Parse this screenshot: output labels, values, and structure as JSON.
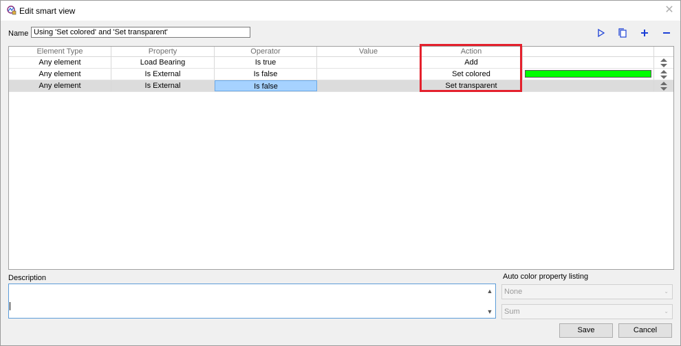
{
  "window": {
    "title": "Edit smart view",
    "close_glyph": "✕"
  },
  "name_field": {
    "label": "Name",
    "value": "Using 'Set colored' and 'Set transparent'"
  },
  "toolbar": {
    "icons": [
      "run-icon",
      "copy-icon",
      "add-icon",
      "remove-icon"
    ]
  },
  "grid": {
    "columns": [
      "Element Type",
      "Property",
      "Operator",
      "Value",
      "Action",
      "",
      ""
    ],
    "rows": [
      {
        "element_type": "Any element",
        "property": "Load Bearing",
        "operator": "Is true",
        "value": "",
        "action": "Add",
        "color": ""
      },
      {
        "element_type": "Any element",
        "property": "Is External",
        "operator": "Is false",
        "value": "",
        "action": "Set colored",
        "color": "#00ff00"
      },
      {
        "element_type": "Any element",
        "property": "Is External",
        "operator": "Is false",
        "value": "",
        "action": "Set transparent",
        "color": ""
      }
    ],
    "selected_row": 2
  },
  "description": {
    "label": "Description",
    "value": ""
  },
  "auto_color": {
    "label": "Auto color property listing",
    "property_value": "None",
    "aggregate_value": "Sum"
  },
  "buttons": {
    "save": "Save",
    "cancel": "Cancel"
  },
  "colors": {
    "highlight": "#e4202c",
    "accent": "#1a3fd6",
    "selection": "#a6d2ff"
  }
}
